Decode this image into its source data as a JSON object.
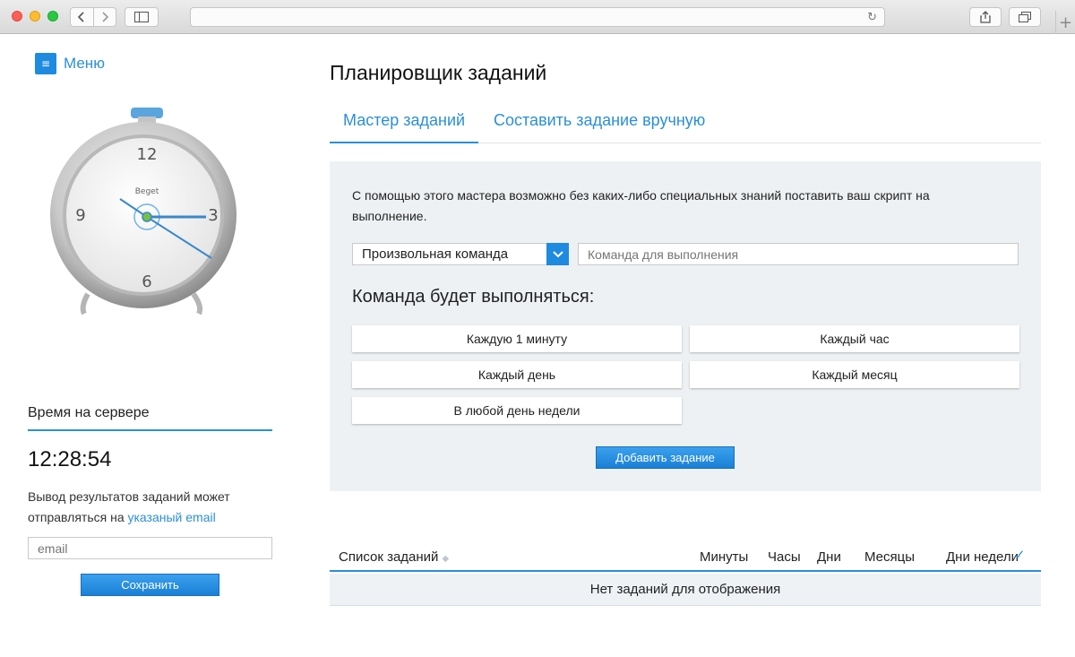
{
  "browser": {
    "address": "",
    "back_icon": "chevron-left-icon",
    "forward_icon": "chevron-right-icon",
    "new_tab": "+"
  },
  "sidebar": {
    "menu_label": "Меню",
    "clock_brand": "Beget",
    "clock_numbers": [
      "12",
      "3",
      "6",
      "9"
    ],
    "server_title": "Время на сервере",
    "server_time": "12:28:54",
    "email_note_text": "Вывод результатов заданий может отправляться на",
    "email_note_link": "указаный email",
    "email_placeholder": "email",
    "save_label": "Сохранить"
  },
  "main": {
    "title": "Планировщик заданий",
    "tabs": [
      {
        "label": "Мастер заданий",
        "active": true
      },
      {
        "label": "Составить задание вручную",
        "active": false
      }
    ],
    "wizard": {
      "description": "С помощью этого мастера возможно без каких-либо специальных знаний поставить ваш скрипт на выполнение.",
      "command_type": "Произвольная команда",
      "command_placeholder": "Команда для выполнения",
      "will_run_title": "Команда будет выполняться:",
      "frequencies": [
        "Каждую 1 минуту",
        "Каждый час",
        "Каждый день",
        "Каждый месяц",
        "В любой день недели"
      ],
      "add_label": "Добавить задание"
    },
    "tasks": {
      "columns": [
        "Список заданий",
        "Минуты",
        "Часы",
        "Дни",
        "Месяцы",
        "Дни недели"
      ],
      "empty_text": "Нет заданий для отображения"
    }
  },
  "colors": {
    "accent": "#2a8fd8",
    "button": "#1e8ae0",
    "panel_bg": "#eef1f4"
  }
}
